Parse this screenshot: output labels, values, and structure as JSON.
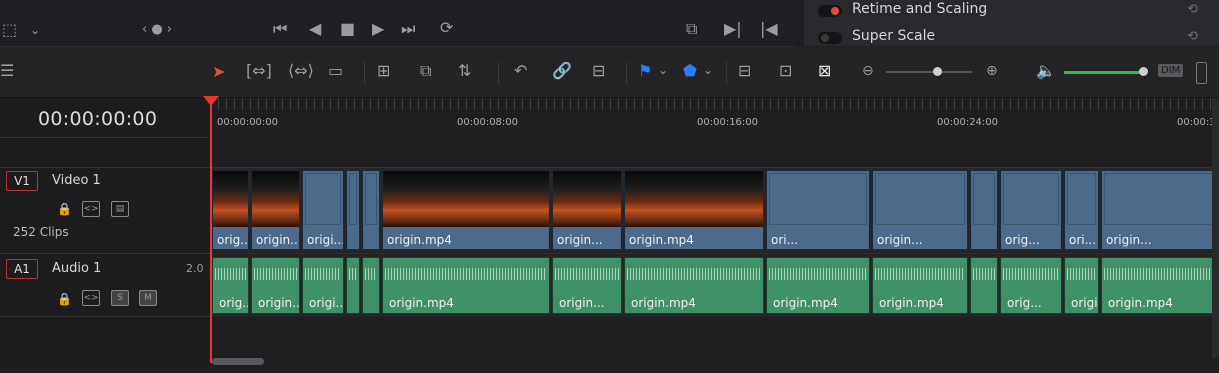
{
  "inspector": {
    "rows": [
      {
        "label": "Retime and Scaling",
        "enabled": true,
        "dot_color": "#e84a3c"
      },
      {
        "label": "Super Scale",
        "enabled": false,
        "dot_color": "#2e2e2e"
      }
    ]
  },
  "transport_icons": [
    "clip-view-icon",
    "chevron-down-icon",
    "prev-next-dots-icon",
    "go-to-start-icon",
    "play-reverse-icon",
    "stop-icon",
    "play-icon",
    "go-to-end-icon",
    "loop-icon",
    "match-frame-icon",
    "next-edit-icon",
    "prev-edit-icon"
  ],
  "toolbar": {
    "icons": [
      "timeline-view-icon",
      "selection-arrow-icon",
      "trim-edit-icon",
      "dynamic-trim-icon",
      "blade-icon",
      "insert-clip-icon",
      "overwrite-clip-icon",
      "replace-clip-icon",
      "snapping-icon",
      "linked-selection-icon",
      "position-lock-icon",
      "flag-icon",
      "marker-icon",
      "zoom-full-icon",
      "zoom-detail-icon",
      "zoom-custom-icon",
      "zoom-out-icon",
      "zoom-in-icon",
      "volume-icon"
    ],
    "dim_label": "DIM",
    "zoom_level": 0.5,
    "volume_level": 1.0
  },
  "timeline": {
    "timecode": "00:00:00:00",
    "ruler_ticks": [
      "00:00:00:00",
      "00:00:08:00",
      "00:00:16:00",
      "00:00:24:00",
      "00:00:3"
    ],
    "tracks": {
      "video": {
        "id": "V1",
        "name": "Video 1",
        "clip_count": "252 Clips"
      },
      "audio": {
        "id": "A1",
        "name": "Audio 1",
        "channels": "2.0",
        "solo_label": "S",
        "mute_label": "M"
      }
    },
    "video_clips": [
      "orig...",
      "origin....",
      "origi...",
      "",
      "",
      "origin.mp4",
      "origin...",
      "origin.mp4",
      "ori...",
      "origin...",
      "",
      "orig...",
      "ori...",
      "origin..."
    ],
    "audio_clips": [
      "orig...",
      "origin....",
      "origi...",
      "",
      "",
      "origin.mp4",
      "origin...",
      "origin.mp4",
      "origin.mp4",
      "origin.mp4",
      "",
      "orig...",
      "origi...",
      "origin.mp4"
    ]
  }
}
